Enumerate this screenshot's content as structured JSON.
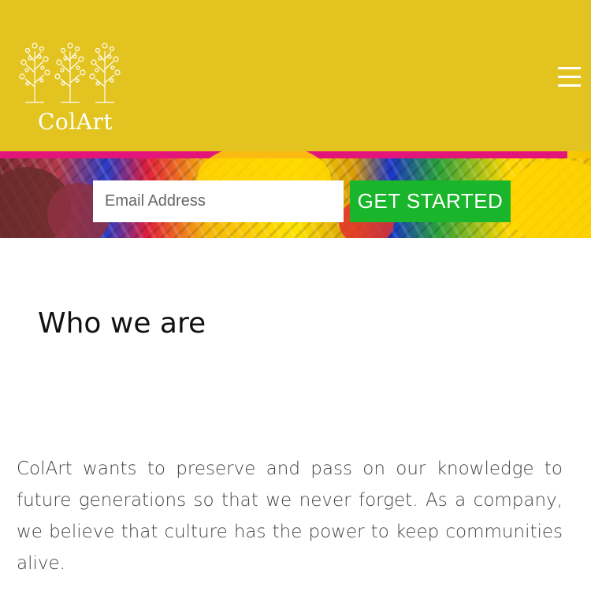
{
  "header": {
    "logo_text": "ColArt",
    "background_color": "#e2c31f",
    "menu_icon": "hamburger-menu-icon"
  },
  "banner": {
    "accent_color": "#e3157a",
    "email_placeholder": "Email Address",
    "cta_label": "GET STARTED",
    "cta_color": "#19b52a"
  },
  "content": {
    "heading": "Who we are",
    "paragraph": "ColArt wants to preserve and pass on our knowledge to future generations so that we never forget. As a company, we believe that culture has the power to keep communities alive."
  }
}
